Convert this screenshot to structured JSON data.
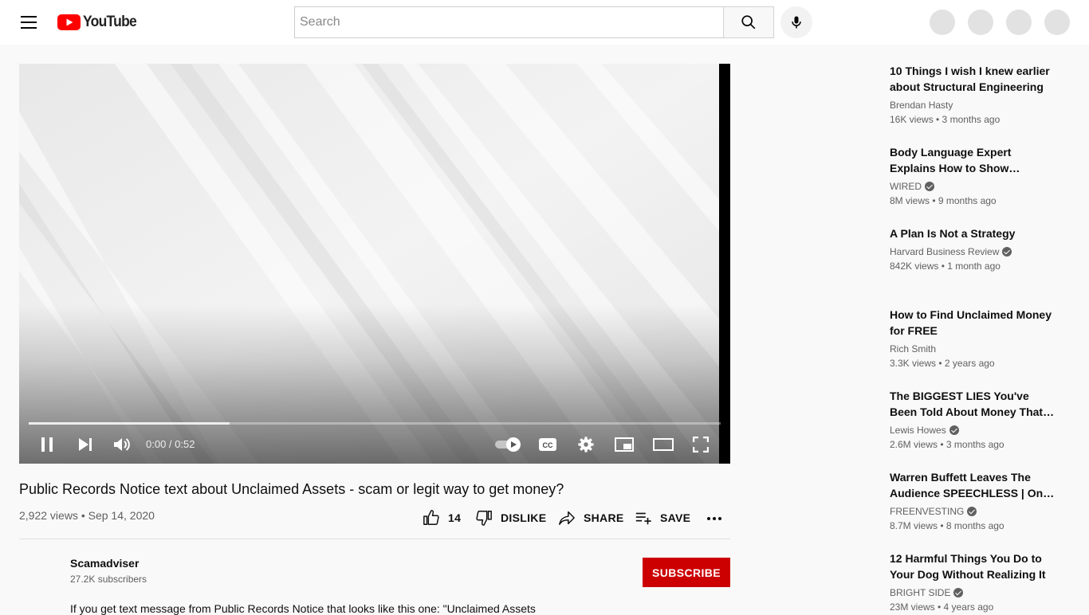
{
  "masthead": {
    "logo_text": "YouTube",
    "search_placeholder": "Search"
  },
  "player": {
    "time_display": "0:00 / 0:52",
    "progress_fraction": 0.29
  },
  "video": {
    "title": "Public Records Notice text about Unclaimed Assets - scam or legit way to get money?",
    "views": "2,922 views",
    "separator": "•",
    "date": "Sep 14, 2020",
    "like_count": "14",
    "dislike_label": "DISLIKE",
    "share_label": "SHARE",
    "save_label": "SAVE"
  },
  "channel": {
    "name": "Scamadviser",
    "subscribers": "27.2K subscribers",
    "subscribe_label": "SUBSCRIBE"
  },
  "description": {
    "text": "If you get text message from Public Records Notice that looks like this one: \"Unclaimed Assets"
  },
  "recommendations": [
    {
      "title": "10 Things I wish I knew earlier about Structural Engineering",
      "channel": "Brendan Hasty",
      "verified": false,
      "stats": "16K views • 3 months ago"
    },
    {
      "title": "Body Language Expert Explains How to Show Confidence | WIRED",
      "channel": "WIRED",
      "verified": true,
      "stats": "8M views • 9 months ago"
    },
    {
      "title": "A Plan Is Not a Strategy",
      "channel": "Harvard Business Review",
      "verified": true,
      "stats": "842K views • 1 month ago"
    },
    {
      "title": "How to Find Unclaimed Money for FREE",
      "channel": "Rich Smith",
      "verified": false,
      "stats": "3.3K views • 2 years ago"
    },
    {
      "title": "The BIGGEST LIES You've Been Told About Money That KEEP You Poor",
      "channel": "Lewis Howes",
      "verified": true,
      "stats": "2.6M views • 3 months ago"
    },
    {
      "title": "Warren Buffett Leaves The Audience SPEECHLESS | One of the Most Inspiring Speeches",
      "channel": "FREENVESTING",
      "verified": true,
      "stats": "8.7M views • 8 months ago"
    },
    {
      "title": "12 Harmful Things You Do to Your Dog Without Realizing It",
      "channel": "BRIGHT SIDE",
      "verified": true,
      "stats": "23M views • 4 years ago"
    }
  ],
  "colors": {
    "brand_red": "#ff0000",
    "subscribe_red": "#cc0000"
  }
}
